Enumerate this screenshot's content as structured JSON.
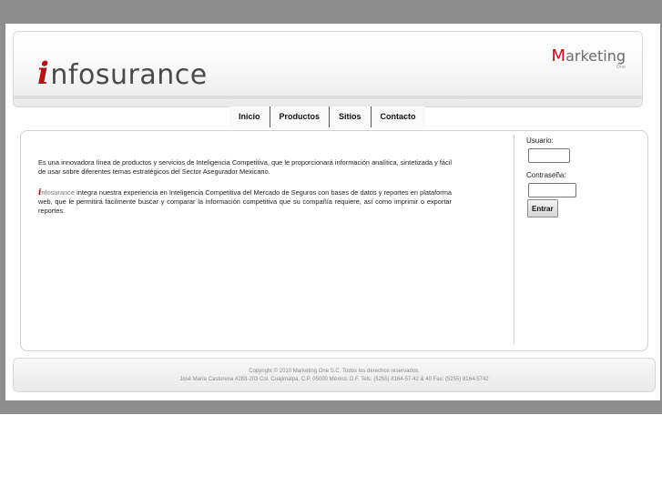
{
  "header": {
    "logo_letter": "i",
    "logo_rest": "nfosurance",
    "brand_first": "M",
    "brand_rest": "arketing",
    "brand_sub": "One"
  },
  "nav": {
    "items": [
      {
        "label": "Inicio"
      },
      {
        "label": "Productos"
      },
      {
        "label": "Sitios"
      },
      {
        "label": "Contacto"
      }
    ]
  },
  "main": {
    "paragraph1": "Es una innovadora línea de productos y servicios de Inteligencia Competitiva, que le proporcionará información analítica, sintetizada y fácil de usar sobre diferentes temas estratégicos del Sector Asegurador Mexicano.",
    "brand_letter": "i",
    "brand_rest": "nfosurance",
    "paragraph2": " integra nuestra experiencia en Inteligencia Competitiva del Mercado de Seguros con bases de datos y reportes en plataforma web, que le permitirá fácilmente buscar y comparar la información competitiva que su compañía requiere, así como imprimir o exportar reportes."
  },
  "login": {
    "user_label": "Usuario:",
    "user_value": "",
    "pass_label": "Contraseña:",
    "pass_value": "",
    "submit_label": "Entrar"
  },
  "footer": {
    "copyright": "Copyright © 2010 Marketing One S.C. Todos los derechos reservados.",
    "address": "José María Castorena #283-203 Col. Cuajimalpa. C.P. 05000 México. D.F. Tels. (5255) 8164-57-42 & 40 Fax: (5255) 8164-5742"
  },
  "colors": {
    "background": "#8e8e8e",
    "brand_red": "#b0141a",
    "text": "#222222"
  }
}
